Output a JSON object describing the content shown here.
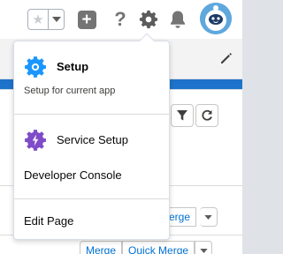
{
  "header": {
    "favorites_icon": "star-icon",
    "favorites_menu_icon": "caret-down-icon",
    "global_actions_icon": "plus-icon",
    "help_icon": "question-icon",
    "help_glyph": "?",
    "setup_icon": "gear-icon",
    "notifications_icon": "bell-icon",
    "avatar_icon": "astro-avatar"
  },
  "setup_menu": {
    "setup": {
      "label": "Setup",
      "subtitle": "Setup for current app"
    },
    "service_setup": {
      "label": "Service Setup"
    },
    "developer_console": {
      "label": "Developer Console"
    },
    "edit_page": {
      "label": "Edit Page"
    }
  },
  "background": {
    "row1": {
      "merge_label": "Merge"
    },
    "row2": {
      "merge_label": "Merge",
      "quick_merge_label": "Quick Merge"
    }
  },
  "colors": {
    "setup_gear": "#1b96ff",
    "service_setup_gear": "#7f4bc8",
    "link": "#0070d2",
    "band": "#2b86d8"
  }
}
